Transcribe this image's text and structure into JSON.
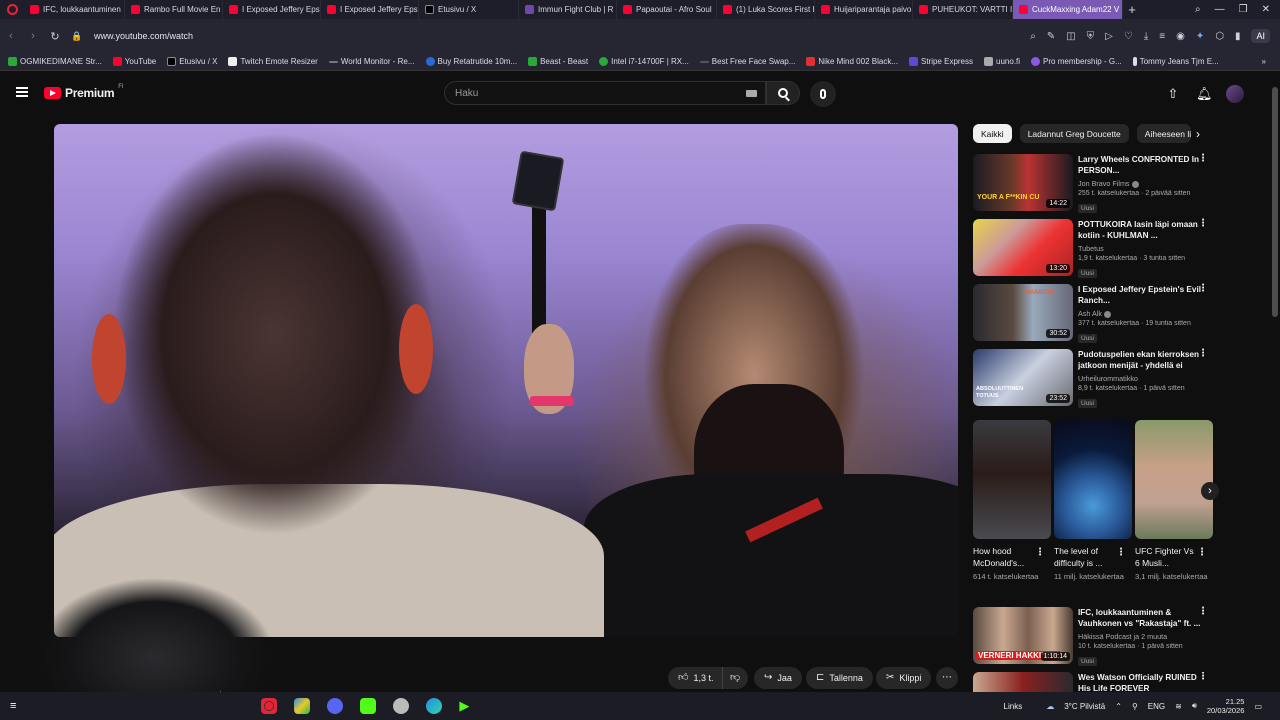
{
  "browser": {
    "tabs": [
      {
        "title": "IFC, loukkaantuminen",
        "icon": "youtube-icon"
      },
      {
        "title": "Rambo Full Movie En",
        "icon": "youtube-icon"
      },
      {
        "title": "I Exposed Jeffery Epst",
        "icon": "youtube-icon"
      },
      {
        "title": "I Exposed Jeffery Epst",
        "icon": "youtube-icon"
      },
      {
        "title": "Etusivu / X",
        "icon": "x-icon"
      },
      {
        "title": "Immun Fight Club | R",
        "icon": "generic-icon"
      },
      {
        "title": "Papaoutai - Afro Soul",
        "icon": "youtube-icon"
      },
      {
        "title": "(1) Luka Scores First L",
        "icon": "youtube-icon"
      },
      {
        "title": "Huijariparantaja paivo",
        "icon": "youtube-icon"
      },
      {
        "title": "PUHEUKOT: VARTTI ISS",
        "icon": "youtube-icon"
      },
      {
        "title": "CuckMaxxing Adam22 V",
        "icon": "youtube-icon",
        "active": true
      }
    ],
    "url": "www.youtube.com/watch",
    "ai_label": "AI",
    "bookmarks": [
      {
        "label": "OGMIKEDIMANE Str...",
        "icon": "green"
      },
      {
        "label": "YouTube",
        "icon": "red"
      },
      {
        "label": "Etusivu / X",
        "icon": "x"
      },
      {
        "label": "Twitch Emote Resizer",
        "icon": "white"
      },
      {
        "label": "World Monitor - Re...",
        "icon": "dash"
      },
      {
        "label": "Buy Retatrutide 10m...",
        "icon": "blue"
      },
      {
        "label": "Beast - Beast",
        "icon": "green"
      },
      {
        "label": "Intel i7-14700F | RX...",
        "icon": "green"
      },
      {
        "label": "Best Free Face Swap...",
        "icon": "dash"
      },
      {
        "label": "Nike Mind 002 Black...",
        "icon": "red"
      },
      {
        "label": "Stripe Express",
        "icon": "purple"
      },
      {
        "label": "uuno.fi",
        "icon": "gray"
      },
      {
        "label": "Pro membership - G...",
        "icon": "purple"
      },
      {
        "label": "Tommy Jeans Tjm E...",
        "icon": "dark"
      }
    ]
  },
  "youtube": {
    "brand": "Premium",
    "region": "FI",
    "search_placeholder": "Haku",
    "actions": {
      "likes": "1,3 t.",
      "share": "Jaa",
      "save": "Tallenna",
      "clip": "Klippi"
    },
    "chips": [
      "Kaikki",
      "Ladannut Greg Doucette",
      "Aiheeseen li"
    ],
    "recommendations": [
      {
        "title": "Larry Wheels CONFRONTED In PERSON...",
        "channel": "Jon Bravo Films",
        "verified": true,
        "views": "255 t. katselukertaa · 2 päivää sitten",
        "badge": "Uusi",
        "duration": "14:22",
        "thumb_text": "YOUR A F**KIN CU"
      },
      {
        "title": "POTTUKOIRA lasin läpi omaan kotiin - KUHLMAN ...",
        "channel": "Tubetus",
        "verified": false,
        "views": "1,9 t. katselukertaa · 3 tuntia sitten",
        "badge": "Uusi",
        "duration": "13:20",
        "thumb_text": ""
      },
      {
        "title": "I Exposed Jeffery Epstein's Evil Ranch...",
        "channel": "Ash Alk",
        "verified": true,
        "views": "377 t. katselukertaa · 19 tuntia sitten",
        "badge": "Uusi",
        "duration": "30:52",
        "thumb_text": "MANSION"
      },
      {
        "title": "Pudotuspelien ekan kierroksen jatkoon menijät - yhdellä ei riit...",
        "channel": "Urheilurommatikko",
        "verified": false,
        "views": "8,9 t. katselukertaa · 1 päivä sitten",
        "badge": "Uusi",
        "duration": "23:52",
        "thumb_text": "ABSOLUUTTINEN TOTUUS"
      },
      {
        "title": "IFC, loukkaantuminen & Vauhkonen vs \"Rakastaja\" ft. ...",
        "channel": "Häkissä Podcast ja 2 muuta",
        "verified": false,
        "views": "10 t. katselukertaa · 1 päivä sitten",
        "badge": "Uusi",
        "duration": "1:10:14",
        "thumb_text": "VERNERI HAKKINEN"
      },
      {
        "title": "Wes Watson Officially RUINED His Life FOREVER",
        "channel": "",
        "verified": false,
        "views": "",
        "badge": "",
        "duration": "",
        "thumb_text": ""
      }
    ],
    "shorts": [
      {
        "title": "How hood McDonald's...",
        "views": "614 t. katselukertaa"
      },
      {
        "title": "The level of difficulty is ...",
        "views": "11 milj. katselukertaa"
      },
      {
        "title": "UFC Fighter Vs 6 Musli...",
        "views": "3,1 milj. katselukertaa"
      }
    ]
  },
  "taskbar": {
    "links_label": "Links",
    "weather": "3°C Pilvistä",
    "lang": "ENG",
    "time": "21.25",
    "date": "20/03/2026"
  }
}
